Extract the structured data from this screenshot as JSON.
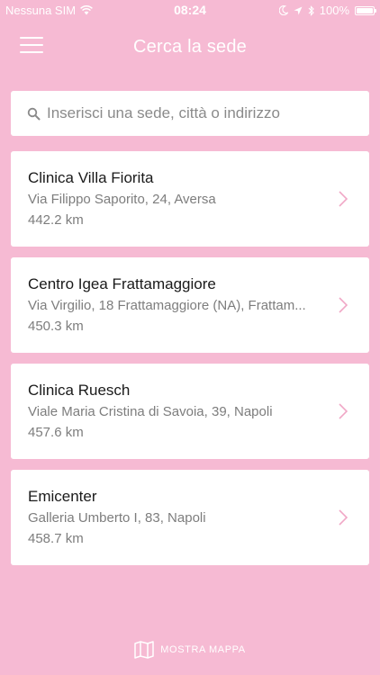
{
  "status_bar": {
    "carrier": "Nessuna SIM",
    "time": "08:24",
    "battery": "100%"
  },
  "header": {
    "title": "Cerca la sede",
    "menu_icon": "hamburger-menu-icon"
  },
  "search": {
    "placeholder": "Inserisci una sede, città o indirizzo",
    "value": "",
    "icon": "search-icon"
  },
  "locations": [
    {
      "name": "Clinica Villa Fiorita",
      "address": "Via Filippo Saporito, 24, Aversa",
      "distance": "442.2 km"
    },
    {
      "name": "Centro Igea Frattamaggiore",
      "address": "Via Virgilio, 18 Frattamaggiore (NA), Frattam...",
      "distance": "450.3 km"
    },
    {
      "name": "Clinica Ruesch",
      "address": "Viale Maria Cristina di Savoia, 39, Napoli",
      "distance": "457.6 km"
    },
    {
      "name": "Emicenter",
      "address": "Galleria Umberto I, 83, Napoli",
      "distance": "458.7 km"
    }
  ],
  "footer": {
    "map_label": "MOSTRA MAPPA",
    "map_icon": "map-icon"
  },
  "colors": {
    "background": "#f6bad3",
    "card": "#ffffff",
    "chevron": "#f0a7c6",
    "text_primary": "#1a1a1a",
    "text_secondary": "#7d7d7d"
  }
}
